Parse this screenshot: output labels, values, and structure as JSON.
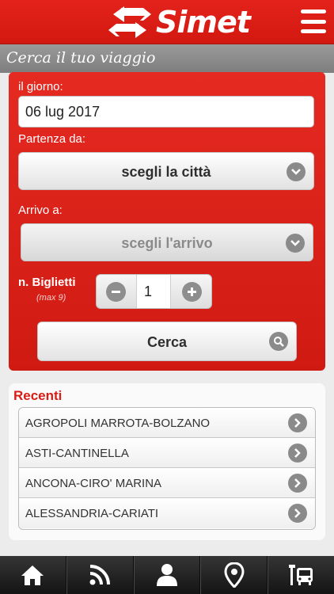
{
  "header": {
    "brand": "Simet",
    "logo_icon": "arrows-icon",
    "menu_icon": "hamburger-icon"
  },
  "titlebar": {
    "title": "Cerca il tuo viaggio"
  },
  "form": {
    "date_label": "il giorno:",
    "date_value": "06 lug 2017",
    "departure_label": "Partenza da:",
    "departure_value": "scegli la città",
    "arrival_label": "Arrivo a:",
    "arrival_value": "scegli l'arrivo",
    "tickets_label": "n. Biglietti",
    "tickets_hint": "(max 9)",
    "tickets_value": "1",
    "search_label": "Cerca"
  },
  "recent": {
    "title": "Recenti",
    "items": [
      {
        "label": "AGROPOLI MARROTA-BOLZANO"
      },
      {
        "label": "ASTI-CANTINELLA"
      },
      {
        "label": "ANCONA-CIRO' MARINA"
      },
      {
        "label": "ALESSANDRIA-CARIATI"
      }
    ]
  },
  "tabbar": {
    "tabs": [
      {
        "icon": "home-icon"
      },
      {
        "icon": "rss-icon"
      },
      {
        "icon": "user-icon"
      },
      {
        "icon": "map-pin-icon"
      },
      {
        "icon": "bus-stop-icon"
      }
    ]
  },
  "colors": {
    "brand_red": "#d81e14",
    "title_gray": "#8a8a8a",
    "tabbar_dark": "#1e1e1e"
  }
}
